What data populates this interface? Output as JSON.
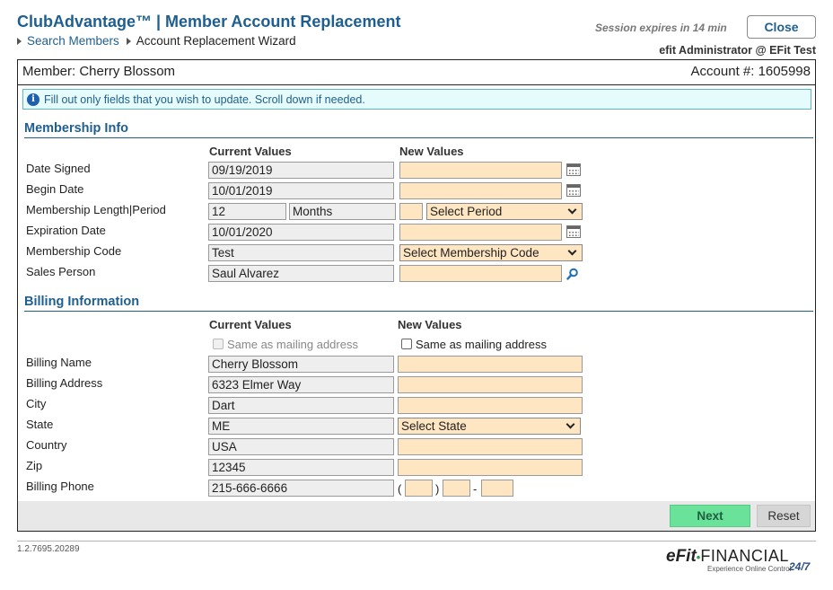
{
  "header": {
    "app_title": "ClubAdvantage™ | Member Account Replacement",
    "breadcrumb_link": "Search Members",
    "breadcrumb_current": "Account Replacement Wizard",
    "session": "Session expires in 14 min",
    "close_label": "Close",
    "admin": "efit Administrator @ EFit Test"
  },
  "member": {
    "name": "Member: Cherry Blossom",
    "account": "Account #: 1605998"
  },
  "info_message": "Fill out only fields that you wish to update. Scroll down if needed.",
  "membership": {
    "title": "Membership Info",
    "current_header": "Current Values",
    "new_header": "New Values",
    "fields": {
      "date_signed": {
        "label": "Date Signed",
        "current": "09/19/2019"
      },
      "begin_date": {
        "label": "Begin Date",
        "current": "10/01/2019"
      },
      "length_period": {
        "label": "Membership Length|Period",
        "current_length": "12",
        "current_period": "Months",
        "period_select": "Select Period"
      },
      "expiration_date": {
        "label": "Expiration Date",
        "current": "10/01/2020"
      },
      "membership_code": {
        "label": "Membership Code",
        "current": "Test",
        "select": "Select Membership Code"
      },
      "sales_person": {
        "label": "Sales Person",
        "current": "Saul Alvarez"
      }
    }
  },
  "billing": {
    "title": "Billing Information",
    "current_header": "Current Values",
    "new_header": "New Values",
    "same_as_mailing": "Same as mailing address",
    "fields": {
      "billing_name": {
        "label": "Billing Name",
        "current": "Cherry Blossom"
      },
      "billing_address": {
        "label": "Billing Address",
        "current": "6323 Elmer Way"
      },
      "city": {
        "label": "City",
        "current": "Dart"
      },
      "state": {
        "label": "State",
        "current": "ME",
        "select": "Select State"
      },
      "country": {
        "label": "Country",
        "current": "USA"
      },
      "zip": {
        "label": "Zip",
        "current": "12345"
      },
      "billing_phone": {
        "label": "Billing Phone",
        "current": "215-666-6666",
        "open_paren": "(",
        "close_paren": ")",
        "dash": "-"
      }
    }
  },
  "actions": {
    "next": "Next",
    "reset": "Reset"
  },
  "footer": {
    "version": "1.2.7695.20289",
    "brand_efit": "eFit",
    "brand_dot": "•",
    "brand_financial": "FINANCIAL",
    "brand_tagline": "Experience Online Control",
    "brand_247": "24/7"
  },
  "colors": {
    "accent": "#1f5f8f",
    "new_value_field": "#ffe6c2",
    "current_value_field": "#eeeeee",
    "next_button": "#6be29a",
    "info_bar": "#e6fbfb"
  }
}
